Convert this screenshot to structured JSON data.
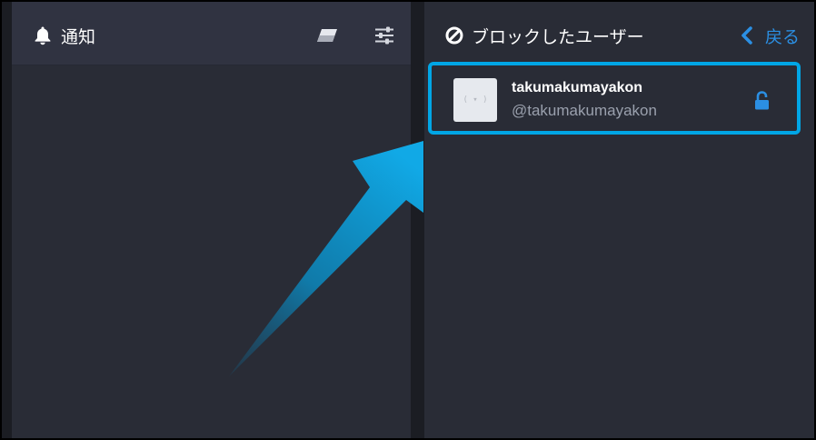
{
  "notifications_column": {
    "title": "通知",
    "icons": {
      "title_icon": "bell-icon",
      "clear_icon": "eraser-icon",
      "settings_icon": "sliders-icon"
    }
  },
  "blocked_column": {
    "title": "ブロックしたユーザー",
    "title_icon": "block-icon",
    "back_label": "戻る",
    "back_icon": "chevron-left-icon",
    "users": [
      {
        "display_name": "takumakumayakon",
        "handle": "@takumakumayakon",
        "avatar_text": "( ▾ )",
        "action_icon": "unlock-icon"
      }
    ]
  },
  "colors": {
    "accent": "#2b8fe3",
    "highlight": "#00a6e6",
    "column_bg": "#292c36",
    "header_bg": "#303341"
  }
}
